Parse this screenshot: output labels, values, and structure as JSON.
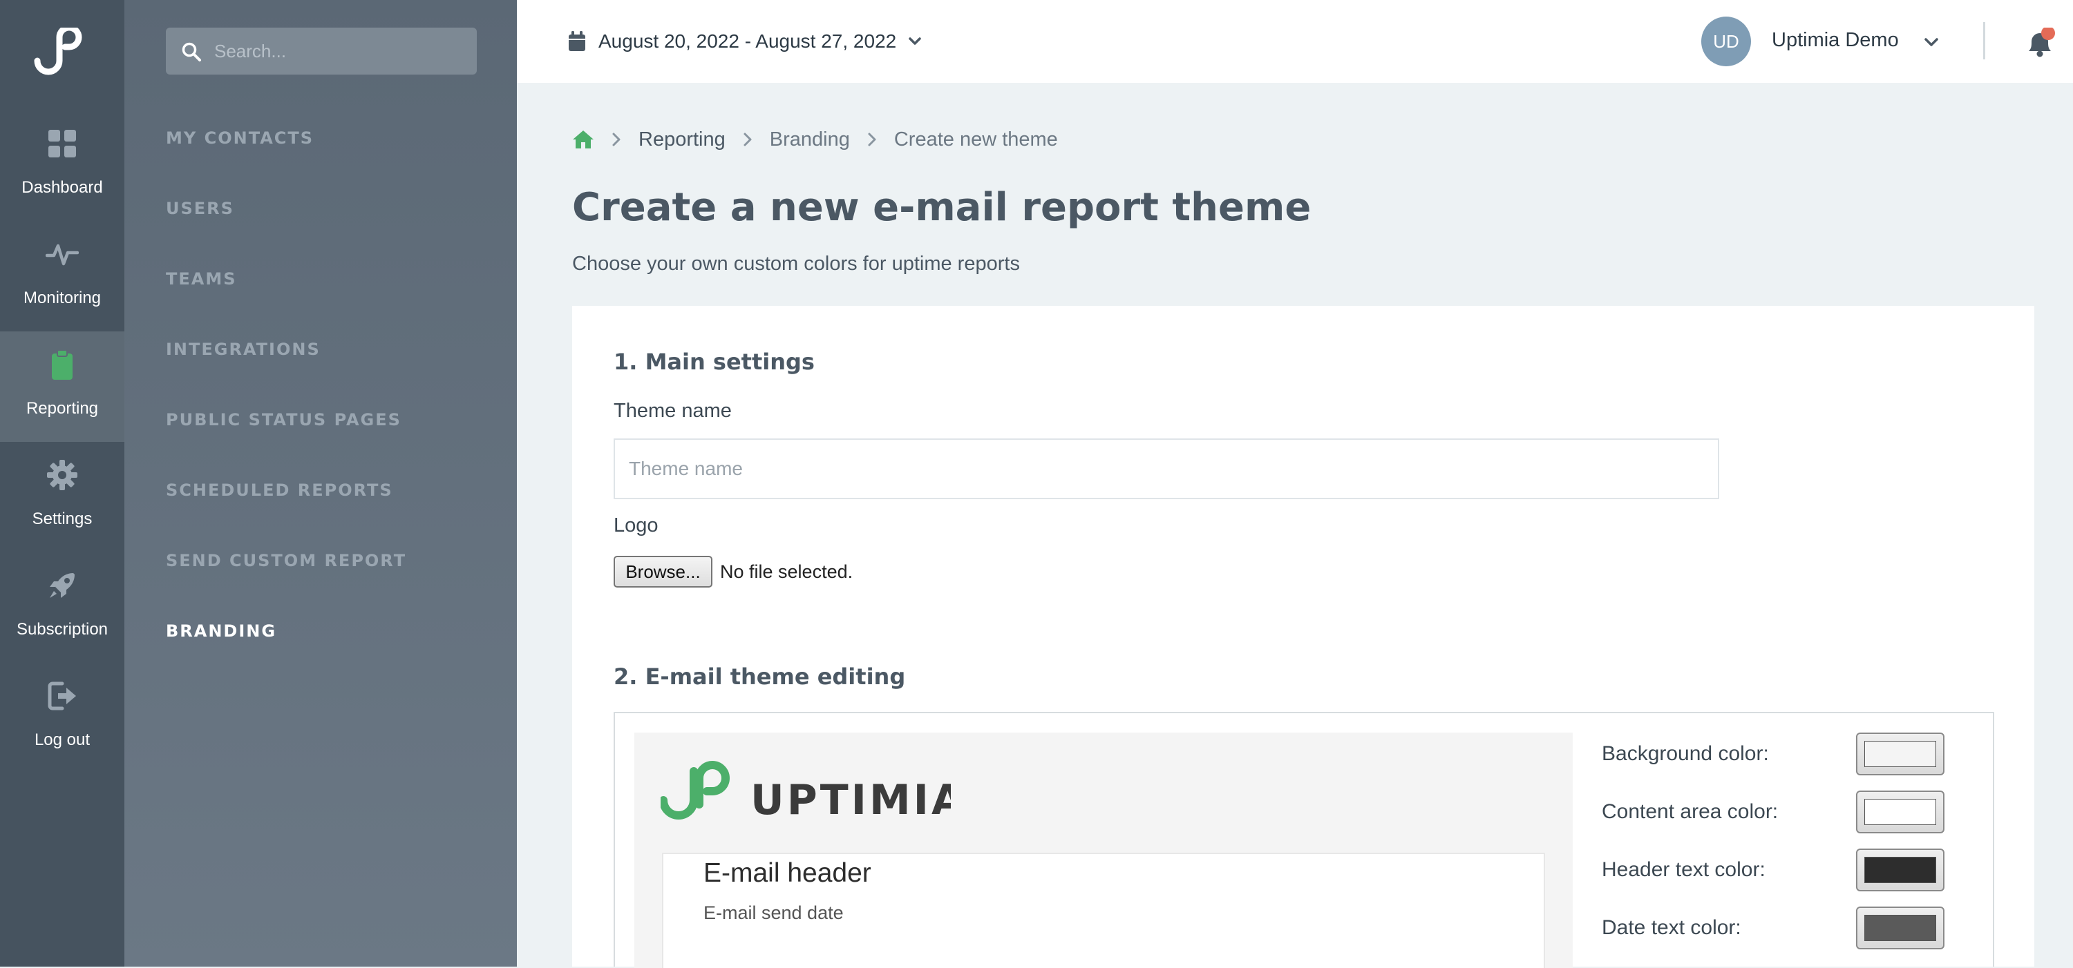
{
  "rail": {
    "items": [
      {
        "label": "Dashboard",
        "icon": "dashboard-icon",
        "active": false
      },
      {
        "label": "Monitoring",
        "icon": "pulse-icon",
        "active": false
      },
      {
        "label": "Reporting",
        "icon": "clipboard-icon",
        "active": true
      },
      {
        "label": "Settings",
        "icon": "gear-icon",
        "active": false
      },
      {
        "label": "Subscription",
        "icon": "rocket-icon",
        "active": false
      },
      {
        "label": "Log out",
        "icon": "logout-icon",
        "active": false
      }
    ]
  },
  "subnav": {
    "search_placeholder": "Search...",
    "items": [
      {
        "label": "MY CONTACTS",
        "active": false
      },
      {
        "label": "USERS",
        "active": false
      },
      {
        "label": "TEAMS",
        "active": false
      },
      {
        "label": "INTEGRATIONS",
        "active": false
      },
      {
        "label": "PUBLIC STATUS PAGES",
        "active": false
      },
      {
        "label": "SCHEDULED REPORTS",
        "active": false
      },
      {
        "label": "SEND CUSTOM REPORT",
        "active": false
      },
      {
        "label": "BRANDING",
        "active": true
      }
    ]
  },
  "topbar": {
    "date_range": "August 20, 2022 - August 27, 2022",
    "avatar_initials": "UD",
    "user_name": "Uptimia Demo"
  },
  "breadcrumb": [
    "Reporting",
    "Branding",
    "Create new theme"
  ],
  "page": {
    "title": "Create a new e-mail report theme",
    "subtitle": "Choose your own custom colors for uptime reports"
  },
  "main_settings": {
    "title": "1. Main settings",
    "theme_name_label": "Theme name",
    "theme_name_placeholder": "Theme name",
    "theme_name_value": "",
    "logo_label": "Logo",
    "browse_label": "Browse...",
    "file_status": "No file selected."
  },
  "theme_editing": {
    "title": "2. E-mail theme editing",
    "preview": {
      "brand": "UPTIMIA",
      "header": "E-mail header",
      "send_date": "E-mail send date"
    },
    "colors": [
      {
        "label": "Background color:",
        "value": "#f4f4f4"
      },
      {
        "label": "Content area color:",
        "value": "#ffffff"
      },
      {
        "label": "Header text color:",
        "value": "#2d2d2d"
      },
      {
        "label": "Date text color:",
        "value": "#5a5a5a"
      }
    ]
  },
  "colors": {
    "accent_green": "#4caf6a",
    "notification_dot": "#e46b57"
  }
}
